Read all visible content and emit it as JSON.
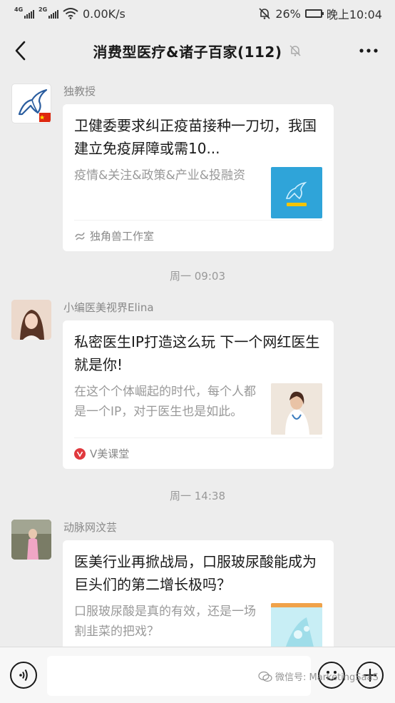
{
  "status_bar": {
    "network_left": "4G",
    "network_right": "2G",
    "speed": "0.00K/s",
    "battery": "26%",
    "battery_level": 0.26,
    "time": "晚上10:04"
  },
  "nav": {
    "title": "消费型医疗&诸子百家(112)"
  },
  "messages": [
    {
      "sender": "独教授",
      "title": "卫健委要求纠正疫苗接种一刀切，我国建立免疫屏障或需10...",
      "desc": "疫情&关注&政策&产业&投融资",
      "source": "独角兽工作室"
    },
    {
      "sender": "小编医美视界Elina",
      "title": "私密医生IP打造这么玩 下一个网红医生就是你!",
      "desc": "在这个个体崛起的时代，每个人都是一个IP，对于医生也是如此。",
      "source": "V美课堂"
    },
    {
      "sender": "动脉网汶芸",
      "title": "医美行业再掀战局，口服玻尿酸能成为巨头们的第二增长极吗？",
      "desc": "口服玻尿酸是真的有效，还是一场割韭菜的把戏？",
      "source": ""
    }
  ],
  "timestamps": [
    "周一 09:03",
    "周一 14:38"
  ],
  "watermark": "微信号: MarketingSaaS"
}
